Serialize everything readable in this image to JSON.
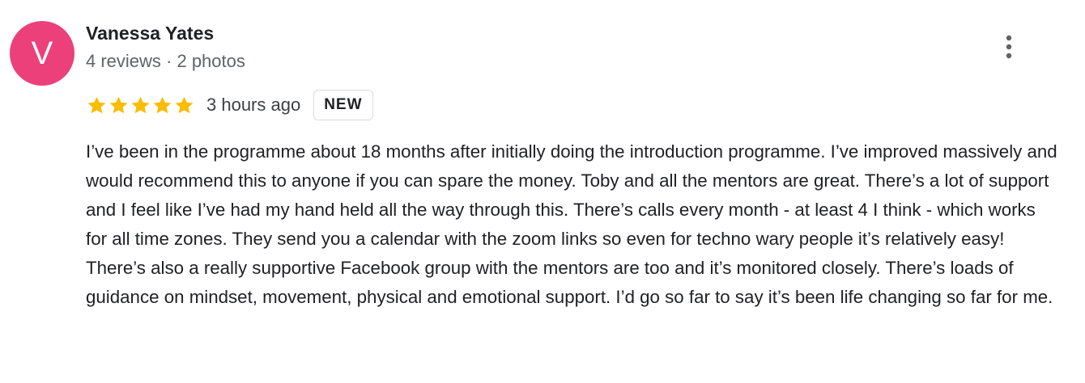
{
  "reviewer": {
    "initial": "V",
    "avatar_color": "#ec407a",
    "name": "Vanessa Yates",
    "meta": "4 reviews · 2 photos"
  },
  "review": {
    "rating": 5,
    "max_rating": 5,
    "star_color": "#fbbc04",
    "time": "3 hours ago",
    "badge": "NEW",
    "text": "I’ve been in the programme about 18 months after initially doing the introduction programme. I’ve improved massively and would recommend this to anyone if you can spare the money. Toby and all the mentors are great. There’s a lot of support and I feel like I’ve had my hand held all the way through this. There’s calls every month - at least 4 I think - which works for all time zones. They send you a calendar with the zoom links so even for techno wary people it’s relatively easy! There’s also a really supportive Facebook group with the mentors are too and it’s monitored closely. There’s loads of guidance on mindset, movement, physical and emotional support. I’d go so far to say it’s been life changing so far for me."
  },
  "icons": {
    "more": "more-vert-icon",
    "star": "star-icon"
  }
}
